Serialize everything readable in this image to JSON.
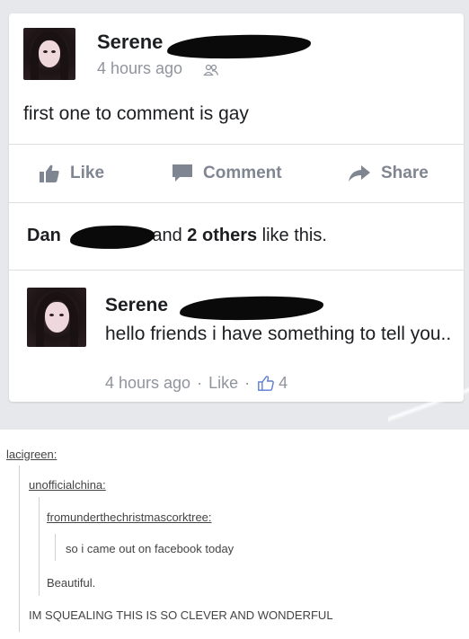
{
  "post": {
    "author": "Serene",
    "timestamp": "4 hours ago",
    "text": "first one to comment is gay"
  },
  "actions": {
    "like": "Like",
    "comment": "Comment",
    "share": "Share"
  },
  "likes": {
    "first_name": "Dan",
    "and_text": "and",
    "others": "2 others",
    "suffix": "like this."
  },
  "comment": {
    "author": "Serene",
    "text": "hello friends i have something to tell you..",
    "timestamp": "4 hours ago",
    "sep1": "·",
    "like_label": "Like",
    "sep2": "·",
    "like_count": "4"
  },
  "thread": [
    {
      "user": "lacigreen:",
      "text": ""
    },
    {
      "user": "unofficialchina:",
      "text": ""
    },
    {
      "user": "fromunderthechristmascorktree:",
      "text": ""
    },
    {
      "user": "",
      "text": "so i came out on facebook today"
    },
    {
      "user": "",
      "text": "Beautiful."
    },
    {
      "user": "",
      "text": "IM SQUEALING THIS IS SO CLEVER AND WONDERFUL"
    }
  ],
  "colors": {
    "fb_background": "#e6e8ec",
    "card": "#ffffff",
    "action_gray": "#7f8591",
    "meta_gray": "#90949c",
    "text": "#1c1e21"
  }
}
